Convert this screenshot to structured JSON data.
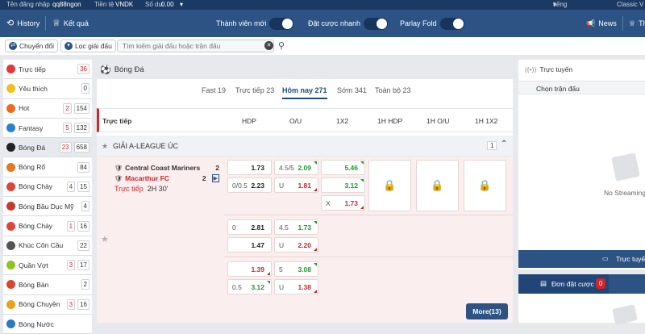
{
  "topbar": {
    "username_label": "Tên đăng nhập",
    "username": "qq88ngon",
    "currency_label": "Tiền tệ",
    "currency": "VNDK",
    "balance_label": "Số dư",
    "balance": "0.00",
    "language": "tiếng việt",
    "theme": "Classic V"
  },
  "nav": {
    "history": "History",
    "results": "Kết quả",
    "member_new": "Thành viên mới",
    "quick_bet": "Đặt cược nhanh",
    "parlay_fold": "Parlay Fold",
    "news": "News",
    "more": "Th"
  },
  "filters": {
    "switch": "Chuyển đổi",
    "filter_league": "Lọc giải đấu",
    "search_placeholder": "Tìm kiếm giải đấu hoặc trận đấu"
  },
  "sidebar": {
    "items": [
      {
        "label": "Trực tiếp",
        "c1": "",
        "c2": "36",
        "icon": "live-icon",
        "color": "#e23a3a"
      },
      {
        "label": "Yêu thích",
        "c1": "",
        "c2": "0",
        "icon": "star-icon",
        "color": "#f2c01d"
      },
      {
        "label": "Hot",
        "c1": "2",
        "c2": "154",
        "icon": "fire-icon",
        "color": "#f06a1e"
      },
      {
        "label": "Fantasy",
        "c1": "5",
        "c2": "132",
        "icon": "fantasy-icon",
        "color": "#2d7fd0"
      },
      {
        "label": "Bóng Đá",
        "c1": "23",
        "c2": "658",
        "icon": "soccer-icon",
        "color": "#222222"
      },
      {
        "label": "Bóng Rổ",
        "c1": "",
        "c2": "84",
        "icon": "basketball-icon",
        "color": "#e87722"
      },
      {
        "label": "Bóng Chày",
        "c1": "4",
        "c2": "15",
        "icon": "baseball-icon",
        "color": "#e0453a"
      },
      {
        "label": "Bóng Bầu Dục Mỹ",
        "c1": "",
        "c2": "4",
        "icon": "american-football-icon",
        "color": "#c53a2e"
      },
      {
        "label": "Bóng Chày",
        "c1": "1",
        "c2": "16",
        "icon": "baseball-icon",
        "color": "#e0453a"
      },
      {
        "label": "Khúc Côn Cầu",
        "c1": "",
        "c2": "22",
        "icon": "hockey-icon",
        "color": "#555555"
      },
      {
        "label": "Quần Vợt",
        "c1": "3",
        "c2": "17",
        "icon": "tennis-icon",
        "color": "#8fc31f"
      },
      {
        "label": "Bóng Bàn",
        "c1": "",
        "c2": "2",
        "icon": "table-tennis-icon",
        "color": "#d9452f"
      },
      {
        "label": "Bóng Chuyền",
        "c1": "3",
        "c2": "16",
        "icon": "volleyball-icon",
        "color": "#e8a21e"
      },
      {
        "label": "Bóng Nước",
        "c1": "",
        "c2": "",
        "icon": "water-polo-icon",
        "color": "#2b79c2"
      }
    ]
  },
  "main": {
    "title": "Bóng Đá",
    "tabs": [
      {
        "label": "Fast 19"
      },
      {
        "label": "Trực tiếp 23"
      },
      {
        "label": "Hôm nay 271"
      },
      {
        "label": "Sớm 341"
      },
      {
        "label": "Toàn bộ 23"
      }
    ],
    "columns": {
      "live": "Trực tiếp",
      "hdp": "HDP",
      "ou": "O/U",
      "x12": "1X2",
      "h1hdp": "1H HDP",
      "h1ou": "1H O/U",
      "h1x12": "1H 1X2"
    },
    "league": {
      "name": "GIẢI A-LEAGUE ÚC",
      "count": "1"
    },
    "match": {
      "home": "Central Coast Mariners",
      "home_score": "2",
      "away": "Macarthur FC",
      "away_score": "2",
      "status": "Trực tiếp",
      "time": "2H 30'"
    },
    "odds": {
      "r1": {
        "hdp_l": "",
        "hdp_v": "1.73",
        "ou_l": "4.5/5",
        "ou_v": "2.09",
        "x_v": "5.46"
      },
      "r2": {
        "hdp_l": "0/0.5",
        "hdp_v": "2.23",
        "ou_l": "U",
        "ou_v": "1.81",
        "x_v": "3.12"
      },
      "r3": {
        "x_l": "X",
        "x_v": "1.73"
      },
      "r4": {
        "hdp_l": "0",
        "hdp_v": "2.81",
        "ou_l": "4.5",
        "ou_v": "1.73"
      },
      "r5": {
        "hdp_v": "1.47",
        "ou_l": "U",
        "ou_v": "2.20"
      },
      "r6": {
        "hdp_v": "1.39",
        "ou_l": "5",
        "ou_v": "3.08"
      },
      "r7": {
        "hdp_l": "0.5",
        "hdp_v": "3.12",
        "ou_l": "U",
        "ou_v": "1.38"
      }
    },
    "more": "More(13)"
  },
  "right": {
    "title": "Trực tuyến",
    "select_match": "Chọn trận đấu",
    "no_stream": "No Streaming",
    "live_button": "Trực tuyến",
    "bet_slip": "Đơn đặt cược",
    "bet_count": "0"
  }
}
